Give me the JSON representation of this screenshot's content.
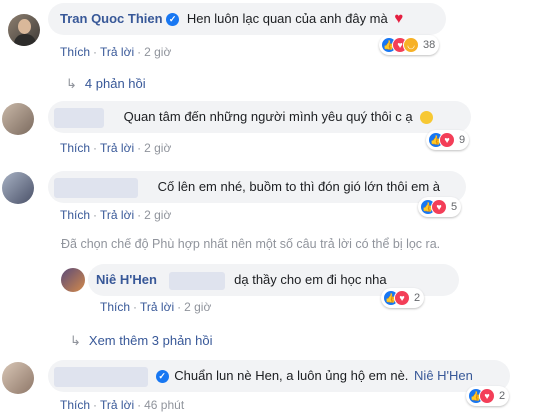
{
  "comments": [
    {
      "name": "Tran Quoc Thien",
      "text": "Hen luôn lạc quan của anh đây mà",
      "like": "Thích",
      "reply": "Trả lời",
      "time": "2 giờ",
      "reaction_count": "38",
      "reactions": [
        "like-icon",
        "love-icon",
        "haha-icon"
      ]
    },
    {
      "text": "Quan tâm đến những người mình yêu quý thôi c ạ",
      "like": "Thích",
      "reply": "Trả lời",
      "time": "2 giờ",
      "reaction_count": "9",
      "reactions": [
        "like-icon",
        "love-icon"
      ]
    },
    {
      "text": "Cố lên em nhé, buồm to thì đón gió lớn thôi em à",
      "like": "Thích",
      "reply": "Trả lời",
      "time": "2 giờ",
      "reaction_count": "5",
      "reactions": [
        "like-icon",
        "love-icon"
      ]
    },
    {
      "name": "Niê H'Hen",
      "text": "dạ thầy cho em đi học nha",
      "like": "Thích",
      "reply": "Trả lời",
      "time": "2 giờ",
      "reaction_count": "2",
      "reactions": [
        "like-icon",
        "love-icon"
      ]
    },
    {
      "text": "Chuẩn lun nè Hen, a luôn ủng hộ em nè.",
      "tag": "Niê H'Hen",
      "like": "Thích",
      "reply": "Trả lời",
      "time": "46 phút",
      "reaction_count": "2",
      "reactions": [
        "like-icon",
        "love-icon"
      ]
    }
  ],
  "replies_link": "4 phản hồi",
  "filter_note": "Đã chọn chế độ Phù hợp nhất nên một số câu trả lời có thể bị lọc ra.",
  "more_replies": "Xem thêm 3 phản hồi",
  "colors": {
    "link": "#385898",
    "bubble": "#f2f3f5",
    "like": "#1877f2",
    "love": "#f33e58",
    "haha": "#f7b125"
  }
}
